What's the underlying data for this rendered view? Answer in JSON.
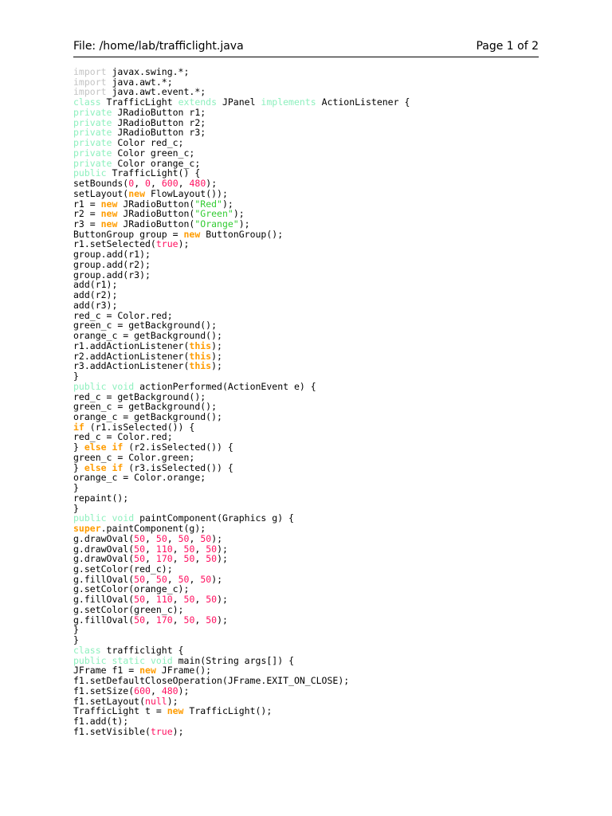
{
  "header": {
    "file": "File: /home/lab/trafficlight.java",
    "page": "Page 1 of 2"
  },
  "code": {
    "lines": [
      [
        [
          "i",
          "import"
        ],
        [
          "p",
          " javax.swing.*;"
        ]
      ],
      [
        [
          "i",
          "import"
        ],
        [
          "p",
          " java.awt.*;"
        ]
      ],
      [
        [
          "i",
          "import"
        ],
        [
          "p",
          " java.awt.event.*;"
        ]
      ],
      [
        [
          "k",
          "class"
        ],
        [
          "p",
          " TrafficLight "
        ],
        [
          "k",
          "extends"
        ],
        [
          "p",
          " JPanel "
        ],
        [
          "k",
          "implements"
        ],
        [
          "p",
          " ActionListener {"
        ]
      ],
      [
        [
          "k",
          "private"
        ],
        [
          "p",
          " JRadioButton r1;"
        ]
      ],
      [
        [
          "k",
          "private"
        ],
        [
          "p",
          " JRadioButton r2;"
        ]
      ],
      [
        [
          "k",
          "private"
        ],
        [
          "p",
          " JRadioButton r3;"
        ]
      ],
      [
        [
          "k",
          "private"
        ],
        [
          "p",
          " Color red_c;"
        ]
      ],
      [
        [
          "k",
          "private"
        ],
        [
          "p",
          " Color green_c;"
        ]
      ],
      [
        [
          "k",
          "private"
        ],
        [
          "p",
          " Color orange_c;"
        ]
      ],
      [
        [
          "k",
          "public"
        ],
        [
          "p",
          " TrafficLight() {"
        ]
      ],
      [
        [
          "p",
          "setBounds("
        ],
        [
          "n",
          "0"
        ],
        [
          "p",
          ", "
        ],
        [
          "n",
          "0"
        ],
        [
          "p",
          ", "
        ],
        [
          "n",
          "600"
        ],
        [
          "p",
          ", "
        ],
        [
          "n",
          "480"
        ],
        [
          "p",
          ");"
        ]
      ],
      [
        [
          "p",
          "setLayout("
        ],
        [
          "o",
          "new"
        ],
        [
          "p",
          " FlowLayout());"
        ]
      ],
      [
        [
          "p",
          "r1 = "
        ],
        [
          "o",
          "new"
        ],
        [
          "p",
          " JRadioButton("
        ],
        [
          "s",
          "\"Red\""
        ],
        [
          "p",
          ");"
        ]
      ],
      [
        [
          "p",
          "r2 = "
        ],
        [
          "o",
          "new"
        ],
        [
          "p",
          " JRadioButton("
        ],
        [
          "s",
          "\"Green\""
        ],
        [
          "p",
          ");"
        ]
      ],
      [
        [
          "p",
          "r3 = "
        ],
        [
          "o",
          "new"
        ],
        [
          "p",
          " JRadioButton("
        ],
        [
          "s",
          "\"Orange\""
        ],
        [
          "p",
          ");"
        ]
      ],
      [
        [
          "p",
          "ButtonGroup group = "
        ],
        [
          "o",
          "new"
        ],
        [
          "p",
          " ButtonGroup();"
        ]
      ],
      [
        [
          "p",
          "r1.setSelected("
        ],
        [
          "n",
          "true"
        ],
        [
          "p",
          ");"
        ]
      ],
      [
        [
          "p",
          "group.add(r1);"
        ]
      ],
      [
        [
          "p",
          "group.add(r2);"
        ]
      ],
      [
        [
          "p",
          "group.add(r3);"
        ]
      ],
      [
        [
          "p",
          "add(r1);"
        ]
      ],
      [
        [
          "p",
          "add(r2);"
        ]
      ],
      [
        [
          "p",
          "add(r3);"
        ]
      ],
      [
        [
          "p",
          "red_c = Color.red;"
        ]
      ],
      [
        [
          "p",
          "green_c = getBackground();"
        ]
      ],
      [
        [
          "p",
          "orange_c = getBackground();"
        ]
      ],
      [
        [
          "p",
          "r1.addActionListener("
        ],
        [
          "o",
          "this"
        ],
        [
          "p",
          ");"
        ]
      ],
      [
        [
          "p",
          "r2.addActionListener("
        ],
        [
          "o",
          "this"
        ],
        [
          "p",
          ");"
        ]
      ],
      [
        [
          "p",
          "r3.addActionListener("
        ],
        [
          "o",
          "this"
        ],
        [
          "p",
          ");"
        ]
      ],
      [
        [
          "p",
          "}"
        ]
      ],
      [
        [
          "k",
          "public"
        ],
        [
          "p",
          " "
        ],
        [
          "k",
          "void"
        ],
        [
          "p",
          " actionPerformed(ActionEvent e) {"
        ]
      ],
      [
        [
          "p",
          "red_c = getBackground();"
        ]
      ],
      [
        [
          "p",
          "green_c = getBackground();"
        ]
      ],
      [
        [
          "p",
          "orange_c = getBackground();"
        ]
      ],
      [
        [
          "o",
          "if"
        ],
        [
          "p",
          " (r1.isSelected()) {"
        ]
      ],
      [
        [
          "p",
          "red_c = Color.red;"
        ]
      ],
      [
        [
          "p",
          "} "
        ],
        [
          "o",
          "else"
        ],
        [
          "p",
          " "
        ],
        [
          "o",
          "if"
        ],
        [
          "p",
          " (r2.isSelected()) {"
        ]
      ],
      [
        [
          "p",
          "green_c = Color.green;"
        ]
      ],
      [
        [
          "p",
          "} "
        ],
        [
          "o",
          "else"
        ],
        [
          "p",
          " "
        ],
        [
          "o",
          "if"
        ],
        [
          "p",
          " (r3.isSelected()) {"
        ]
      ],
      [
        [
          "p",
          "orange_c = Color.orange;"
        ]
      ],
      [
        [
          "p",
          "}"
        ]
      ],
      [
        [
          "p",
          "repaint();"
        ]
      ],
      [
        [
          "p",
          "}"
        ]
      ],
      [
        [
          "k",
          "public"
        ],
        [
          "p",
          " "
        ],
        [
          "k",
          "void"
        ],
        [
          "p",
          " paintComponent(Graphics g) {"
        ]
      ],
      [
        [
          "o",
          "super"
        ],
        [
          "p",
          ".paintComponent(g);"
        ]
      ],
      [
        [
          "p",
          "g.drawOval("
        ],
        [
          "n",
          "50"
        ],
        [
          "p",
          ", "
        ],
        [
          "n",
          "50"
        ],
        [
          "p",
          ", "
        ],
        [
          "n",
          "50"
        ],
        [
          "p",
          ", "
        ],
        [
          "n",
          "50"
        ],
        [
          "p",
          ");"
        ]
      ],
      [
        [
          "p",
          "g.drawOval("
        ],
        [
          "n",
          "50"
        ],
        [
          "p",
          ", "
        ],
        [
          "n",
          "110"
        ],
        [
          "p",
          ", "
        ],
        [
          "n",
          "50"
        ],
        [
          "p",
          ", "
        ],
        [
          "n",
          "50"
        ],
        [
          "p",
          ");"
        ]
      ],
      [
        [
          "p",
          "g.drawOval("
        ],
        [
          "n",
          "50"
        ],
        [
          "p",
          ", "
        ],
        [
          "n",
          "170"
        ],
        [
          "p",
          ", "
        ],
        [
          "n",
          "50"
        ],
        [
          "p",
          ", "
        ],
        [
          "n",
          "50"
        ],
        [
          "p",
          ");"
        ]
      ],
      [
        [
          "p",
          "g.setColor(red_c);"
        ]
      ],
      [
        [
          "p",
          "g.fillOval("
        ],
        [
          "n",
          "50"
        ],
        [
          "p",
          ", "
        ],
        [
          "n",
          "50"
        ],
        [
          "p",
          ", "
        ],
        [
          "n",
          "50"
        ],
        [
          "p",
          ", "
        ],
        [
          "n",
          "50"
        ],
        [
          "p",
          ");"
        ]
      ],
      [
        [
          "p",
          "g.setColor(orange_c);"
        ]
      ],
      [
        [
          "p",
          "g.fillOval("
        ],
        [
          "n",
          "50"
        ],
        [
          "p",
          ", "
        ],
        [
          "n",
          "110"
        ],
        [
          "p",
          ", "
        ],
        [
          "n",
          "50"
        ],
        [
          "p",
          ", "
        ],
        [
          "n",
          "50"
        ],
        [
          "p",
          ");"
        ]
      ],
      [
        [
          "p",
          "g.setColor(green_c);"
        ]
      ],
      [
        [
          "p",
          "g.fillOval("
        ],
        [
          "n",
          "50"
        ],
        [
          "p",
          ", "
        ],
        [
          "n",
          "170"
        ],
        [
          "p",
          ", "
        ],
        [
          "n",
          "50"
        ],
        [
          "p",
          ", "
        ],
        [
          "n",
          "50"
        ],
        [
          "p",
          ");"
        ]
      ],
      [
        [
          "p",
          "}"
        ]
      ],
      [
        [
          "p",
          "}"
        ]
      ],
      [
        [
          "k",
          "class"
        ],
        [
          "p",
          " trafficlight {"
        ]
      ],
      [
        [
          "k",
          "public"
        ],
        [
          "p",
          " "
        ],
        [
          "k",
          "static"
        ],
        [
          "p",
          " "
        ],
        [
          "k",
          "void"
        ],
        [
          "p",
          " main(String args[]) {"
        ]
      ],
      [
        [
          "p",
          "JFrame f1 = "
        ],
        [
          "o",
          "new"
        ],
        [
          "p",
          " JFrame();"
        ]
      ],
      [
        [
          "p",
          "f1.setDefaultCloseOperation(JFrame.EXIT_ON_CLOSE);"
        ]
      ],
      [
        [
          "p",
          "f1.setSize("
        ],
        [
          "n",
          "600"
        ],
        [
          "p",
          ", "
        ],
        [
          "n",
          "480"
        ],
        [
          "p",
          ");"
        ]
      ],
      [
        [
          "p",
          "f1.setLayout("
        ],
        [
          "n",
          "null"
        ],
        [
          "p",
          ");"
        ]
      ],
      [
        [
          "p",
          "TrafficLight t = "
        ],
        [
          "o",
          "new"
        ],
        [
          "p",
          " TrafficLight();"
        ]
      ],
      [
        [
          "p",
          "f1.add(t);"
        ]
      ],
      [
        [
          "p",
          "f1.setVisible("
        ],
        [
          "n",
          "true"
        ],
        [
          "p",
          ");"
        ]
      ]
    ]
  }
}
